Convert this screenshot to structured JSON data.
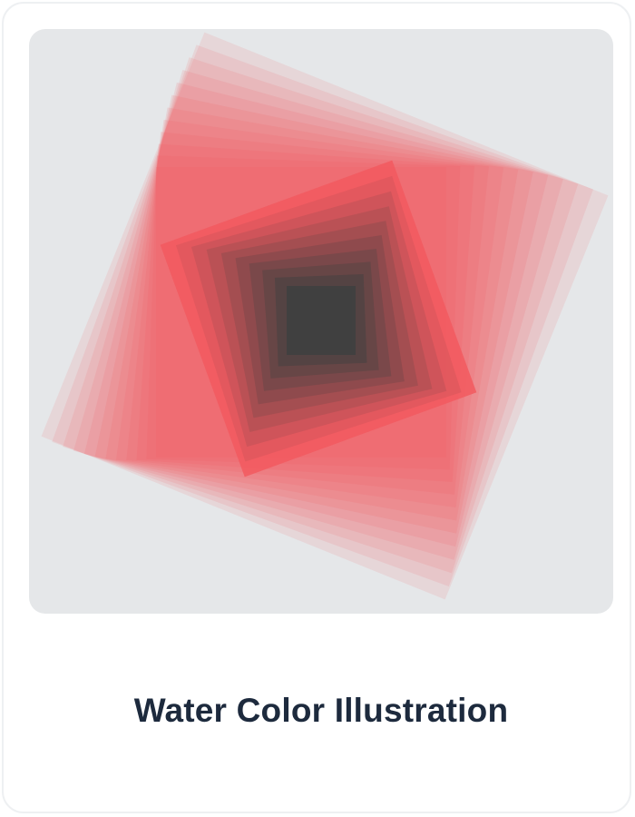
{
  "card": {
    "title": "Water Color Illustration"
  },
  "illustration": {
    "icon": "watercolor-artwork",
    "background_color": "#e5e7e9",
    "accent_color": "#f2595f",
    "core_color": "#404040",
    "outer_layers": 12,
    "inner_layers": 10
  }
}
